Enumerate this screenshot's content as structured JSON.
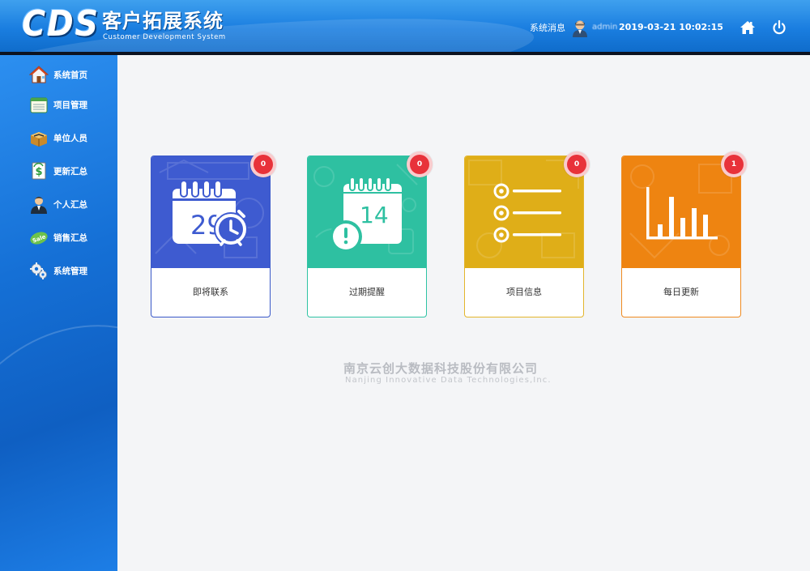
{
  "header": {
    "logo": "CDS",
    "title": "客户拓展系统",
    "subtitle": "Customer Development System",
    "message_label": "系统消息",
    "username": "admin",
    "datetime": "2019-03-21 10:02:15",
    "home_icon": "home-icon",
    "power_icon": "power-icon"
  },
  "sidebar": {
    "items": [
      {
        "label": "系统首页",
        "icon": "house-icon"
      },
      {
        "label": "项目管理",
        "icon": "notepad-icon"
      },
      {
        "label": "单位人员",
        "icon": "box-icon"
      },
      {
        "label": "更新汇总",
        "icon": "refresh-doc-icon"
      },
      {
        "label": "个人汇总",
        "icon": "person-icon"
      },
      {
        "label": "销售汇总",
        "icon": "sale-tag-icon"
      },
      {
        "label": "系统管理",
        "icon": "gears-icon"
      }
    ]
  },
  "cards": [
    {
      "label": "即将联系",
      "badge": "0",
      "icon": "calendar-alarm-icon",
      "color": "#3e5bd0",
      "calendar_text": "29"
    },
    {
      "label": "过期提醒",
      "badge": "0",
      "icon": "calendar-warning-icon",
      "color": "#2ec0a1",
      "calendar_text": "14"
    },
    {
      "label": "项目信息",
      "badge": "0",
      "icon": "list-icon",
      "color": "#dfae18"
    },
    {
      "label": "每日更新",
      "badge": "1",
      "icon": "bar-chart-icon",
      "color": "#ee8411"
    }
  ],
  "footer": {
    "company_cn": "南京云创大数据科技股份有限公司",
    "company_en": "Nanjing Innovative Data Technologies,Inc."
  },
  "colors": {
    "header_blue": "#1a7ee0",
    "sidebar_blue": "#1570d6",
    "badge_red": "#e8323a"
  }
}
